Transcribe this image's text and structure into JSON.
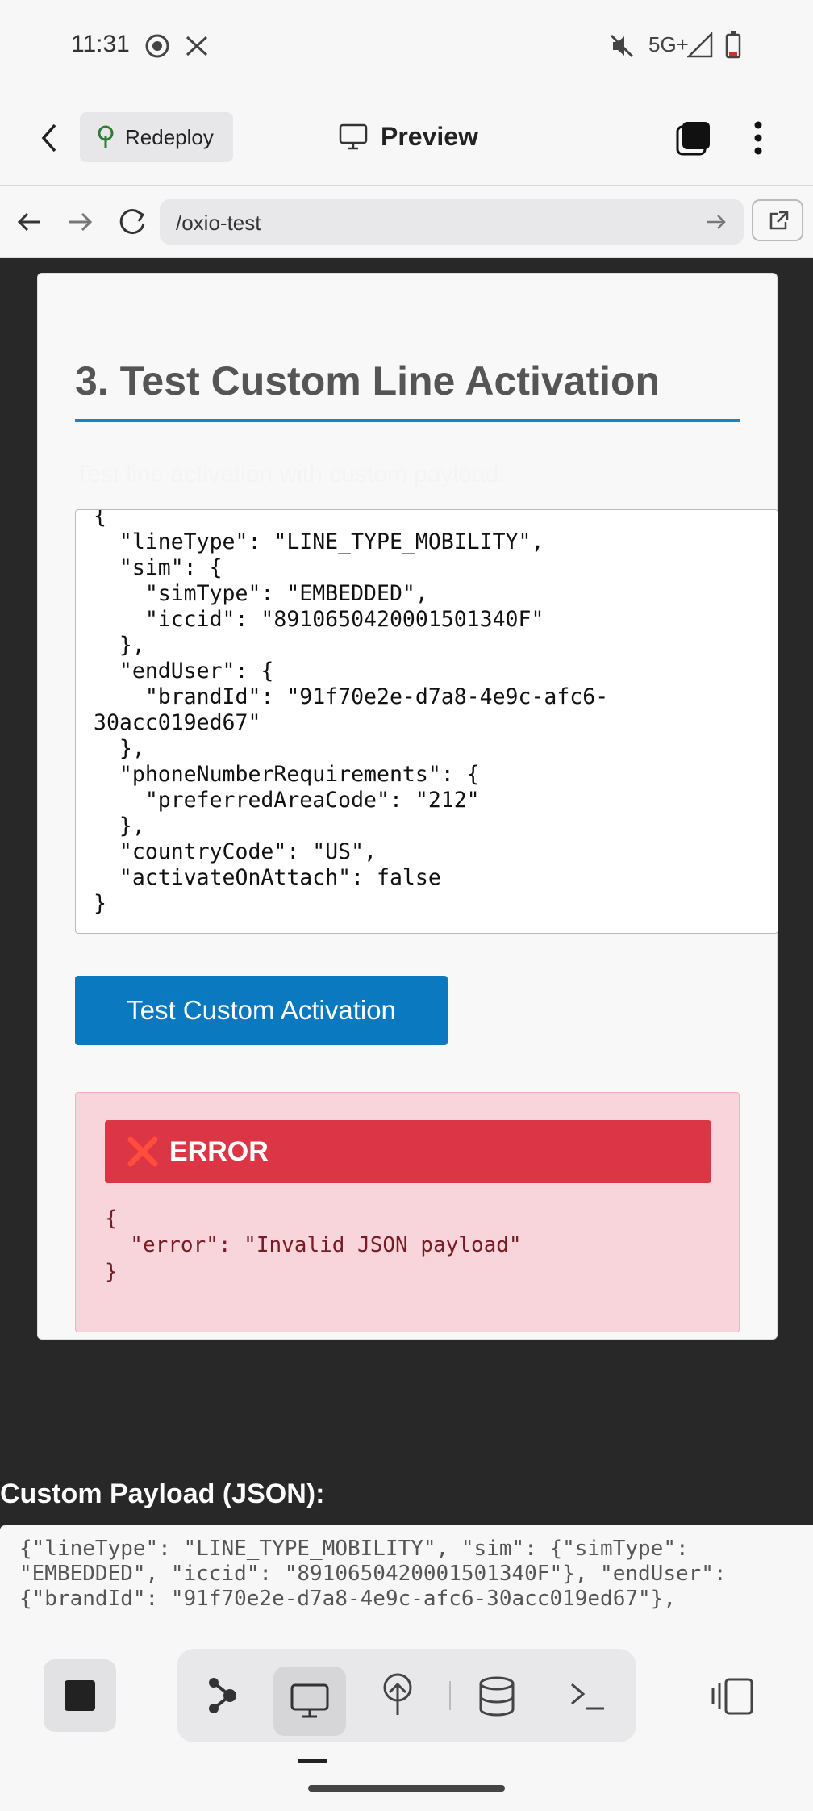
{
  "status_bar": {
    "time": "11:31",
    "network": "5G+"
  },
  "app_header": {
    "back_icon": "chevron-left-icon",
    "redeploy_label": "Redeploy",
    "preview_label": "Preview",
    "menu_icon": "more-vertical-icon"
  },
  "browser": {
    "url": "/oxio-test"
  },
  "section": {
    "title": "3. Test Custom Line Activation",
    "subtitle": "Test line activation with custom payload.",
    "payload_text": "{\n  \"lineType\": \"LINE_TYPE_MOBILITY\",\n  \"sim\": {\n    \"simType\": \"EMBEDDED\",\n    \"iccid\": \"8910650420001501340F\"\n  },\n  \"endUser\": {\n    \"brandId\": \"91f70e2e-d7a8-4e9c-afc6-\n30acc019ed67\"\n  },\n  \"phoneNumberRequirements\": {\n    \"preferredAreaCode\": \"212\"\n  },\n  \"countryCode\": \"US\",\n  \"activateOnAttach\": false\n}",
    "button_label": "Test Custom Activation",
    "error_title": "ERROR",
    "error_body": "{\n  \"error\": \"Invalid JSON payload\"\n}"
  },
  "custom_payload": {
    "label": "Custom Payload (JSON):",
    "text": "{\"lineType\": \"LINE_TYPE_MOBILITY\", \"sim\": {\"simType\":\n\"EMBEDDED\", \"iccid\": \"8910650420001501340F\"}, \"endUser\":\n{\"brandId\": \"91f70e2e-d7a8-4e9c-afc6-30acc019ed67\"},"
  },
  "colors": {
    "accent_blue": "#0a79bf",
    "error_red": "#dc3545",
    "error_bg": "#f7d5da"
  }
}
